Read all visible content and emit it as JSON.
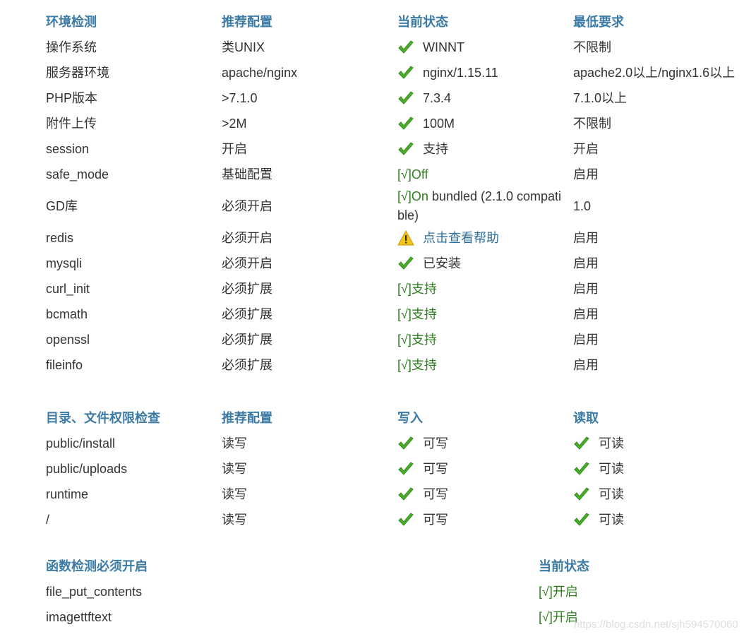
{
  "env": {
    "headers": [
      "环境检测",
      "推荐配置",
      "当前状态",
      "最低要求"
    ],
    "rows": [
      {
        "name": "操作系统",
        "recommended": "类UNIX",
        "status": "WINNT",
        "status_type": "ok",
        "minimum": "不限制"
      },
      {
        "name": "服务器环境",
        "recommended": "apache/nginx",
        "status": "nginx/1.15.11",
        "status_type": "ok",
        "minimum": "apache2.0以上/nginx1.6以上"
      },
      {
        "name": "PHP版本",
        "recommended": ">7.1.0",
        "status": "7.3.4",
        "status_type": "ok",
        "minimum": "7.1.0以上"
      },
      {
        "name": "附件上传",
        "recommended": ">2M",
        "status": "100M",
        "status_type": "ok",
        "minimum": "不限制"
      },
      {
        "name": "session",
        "recommended": "开启",
        "status": "支持",
        "status_type": "ok",
        "minimum": "开启"
      },
      {
        "name": "safe_mode",
        "recommended": "基础配置",
        "status": "[√]Off",
        "status_type": "text-green",
        "minimum": "启用"
      },
      {
        "name": "GD库",
        "recommended": "必须开启",
        "status_prefix": "[√]On",
        "status": "bundled (2.1.0 compatible)",
        "status_type": "gd",
        "minimum": "1.0"
      },
      {
        "name": "redis",
        "recommended": "必须开启",
        "status": "点击查看帮助",
        "status_type": "warn",
        "minimum": "启用"
      },
      {
        "name": "mysqli",
        "recommended": "必须开启",
        "status": "已安装",
        "status_type": "ok",
        "minimum": "启用"
      },
      {
        "name": "curl_init",
        "recommended": "必须扩展",
        "status": "[√]支持",
        "status_type": "text-green",
        "minimum": "启用"
      },
      {
        "name": "bcmath",
        "recommended": "必须扩展",
        "status": "[√]支持",
        "status_type": "text-green",
        "minimum": "启用"
      },
      {
        "name": "openssl",
        "recommended": "必须扩展",
        "status": "[√]支持",
        "status_type": "text-green",
        "minimum": "启用"
      },
      {
        "name": "fileinfo",
        "recommended": "必须扩展",
        "status": "[√]支持",
        "status_type": "text-green",
        "minimum": "启用"
      }
    ]
  },
  "dirs": {
    "headers": [
      "目录、文件权限检查",
      "推荐配置",
      "写入",
      "读取"
    ],
    "rows": [
      {
        "path": "public/install",
        "recommended": "读写",
        "write": "可写",
        "read": "可读"
      },
      {
        "path": "public/uploads",
        "recommended": "读写",
        "write": "可写",
        "read": "可读"
      },
      {
        "path": "runtime",
        "recommended": "读写",
        "write": "可写",
        "read": "可读"
      },
      {
        "path": "/",
        "recommended": "读写",
        "write": "可写",
        "read": "可读"
      }
    ]
  },
  "funcs": {
    "headers": [
      "函数检测必须开启",
      "当前状态"
    ],
    "rows": [
      {
        "name": "file_put_contents",
        "status": "[√]开启"
      },
      {
        "name": "imagettftext",
        "status": "[√]开启"
      }
    ]
  },
  "watermark": "https://blog.csdn.net/sjh594570060",
  "colors": {
    "header": "#3b7ba5",
    "ok_green": "#2e7d1e",
    "check_icon": "#4caf2a",
    "warn_yellow": "#f5c518",
    "link": "#2f6f9f"
  }
}
